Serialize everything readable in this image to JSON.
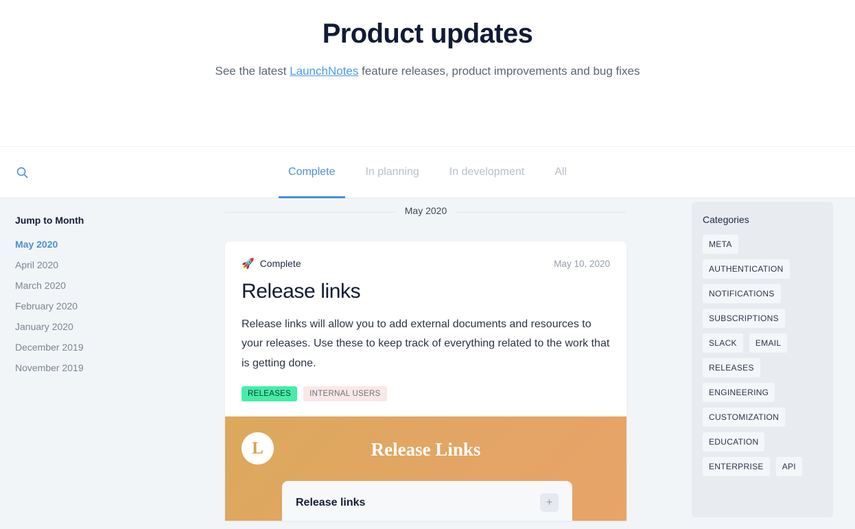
{
  "hero": {
    "title": "Product updates",
    "subtitle_before": "See the latest ",
    "brand": "LaunchNotes",
    "subtitle_after": " feature releases, product improvements and bug fixes"
  },
  "nav": {
    "search_icon": "search-icon",
    "tabs": [
      {
        "label": "Complete",
        "active": true
      },
      {
        "label": "In planning",
        "active": false
      },
      {
        "label": "In development",
        "active": false
      },
      {
        "label": "All",
        "active": false
      }
    ]
  },
  "sidebar_left": {
    "heading": "Jump to Month",
    "months": [
      {
        "label": "May 2020",
        "active": true
      },
      {
        "label": "April 2020",
        "active": false
      },
      {
        "label": "March 2020",
        "active": false
      },
      {
        "label": "February 2020",
        "active": false
      },
      {
        "label": "January 2020",
        "active": false
      },
      {
        "label": "December 2019",
        "active": false
      },
      {
        "label": "November 2019",
        "active": false
      }
    ]
  },
  "main": {
    "month_divider": "May 2020",
    "card": {
      "status_icon": "rocket-icon",
      "status_glyph": "🚀",
      "status_label": "Complete",
      "date": "May 10, 2020",
      "title": "Release links",
      "body": "Release links will allow you to add external documents and resources to your releases. Use these to keep track of everything related to the work that is getting done.",
      "tags": [
        {
          "label": "RELEASES",
          "color": "#45eda8"
        },
        {
          "label": "INTERNAL USERS",
          "color": "#fae7e7"
        }
      ],
      "banner": {
        "logo_letter": "L",
        "title": "Release Links",
        "inner_title": "Release links",
        "add_button": "+",
        "gradient_from": "#dba95c",
        "gradient_to": "#e8a469"
      }
    }
  },
  "sidebar_right": {
    "heading": "Categories",
    "categories": [
      "META",
      "AUTHENTICATION",
      "NOTIFICATIONS",
      "SUBSCRIPTIONS",
      "SLACK",
      "EMAIL",
      "RELEASES",
      "ENGINEERING",
      "CUSTOMIZATION",
      "EDUCATION",
      "ENTERPRISE",
      "API"
    ]
  },
  "colors": {
    "accent": "#4a90d9",
    "page_bg": "#f2f5f8",
    "text_dark": "#121b35"
  }
}
